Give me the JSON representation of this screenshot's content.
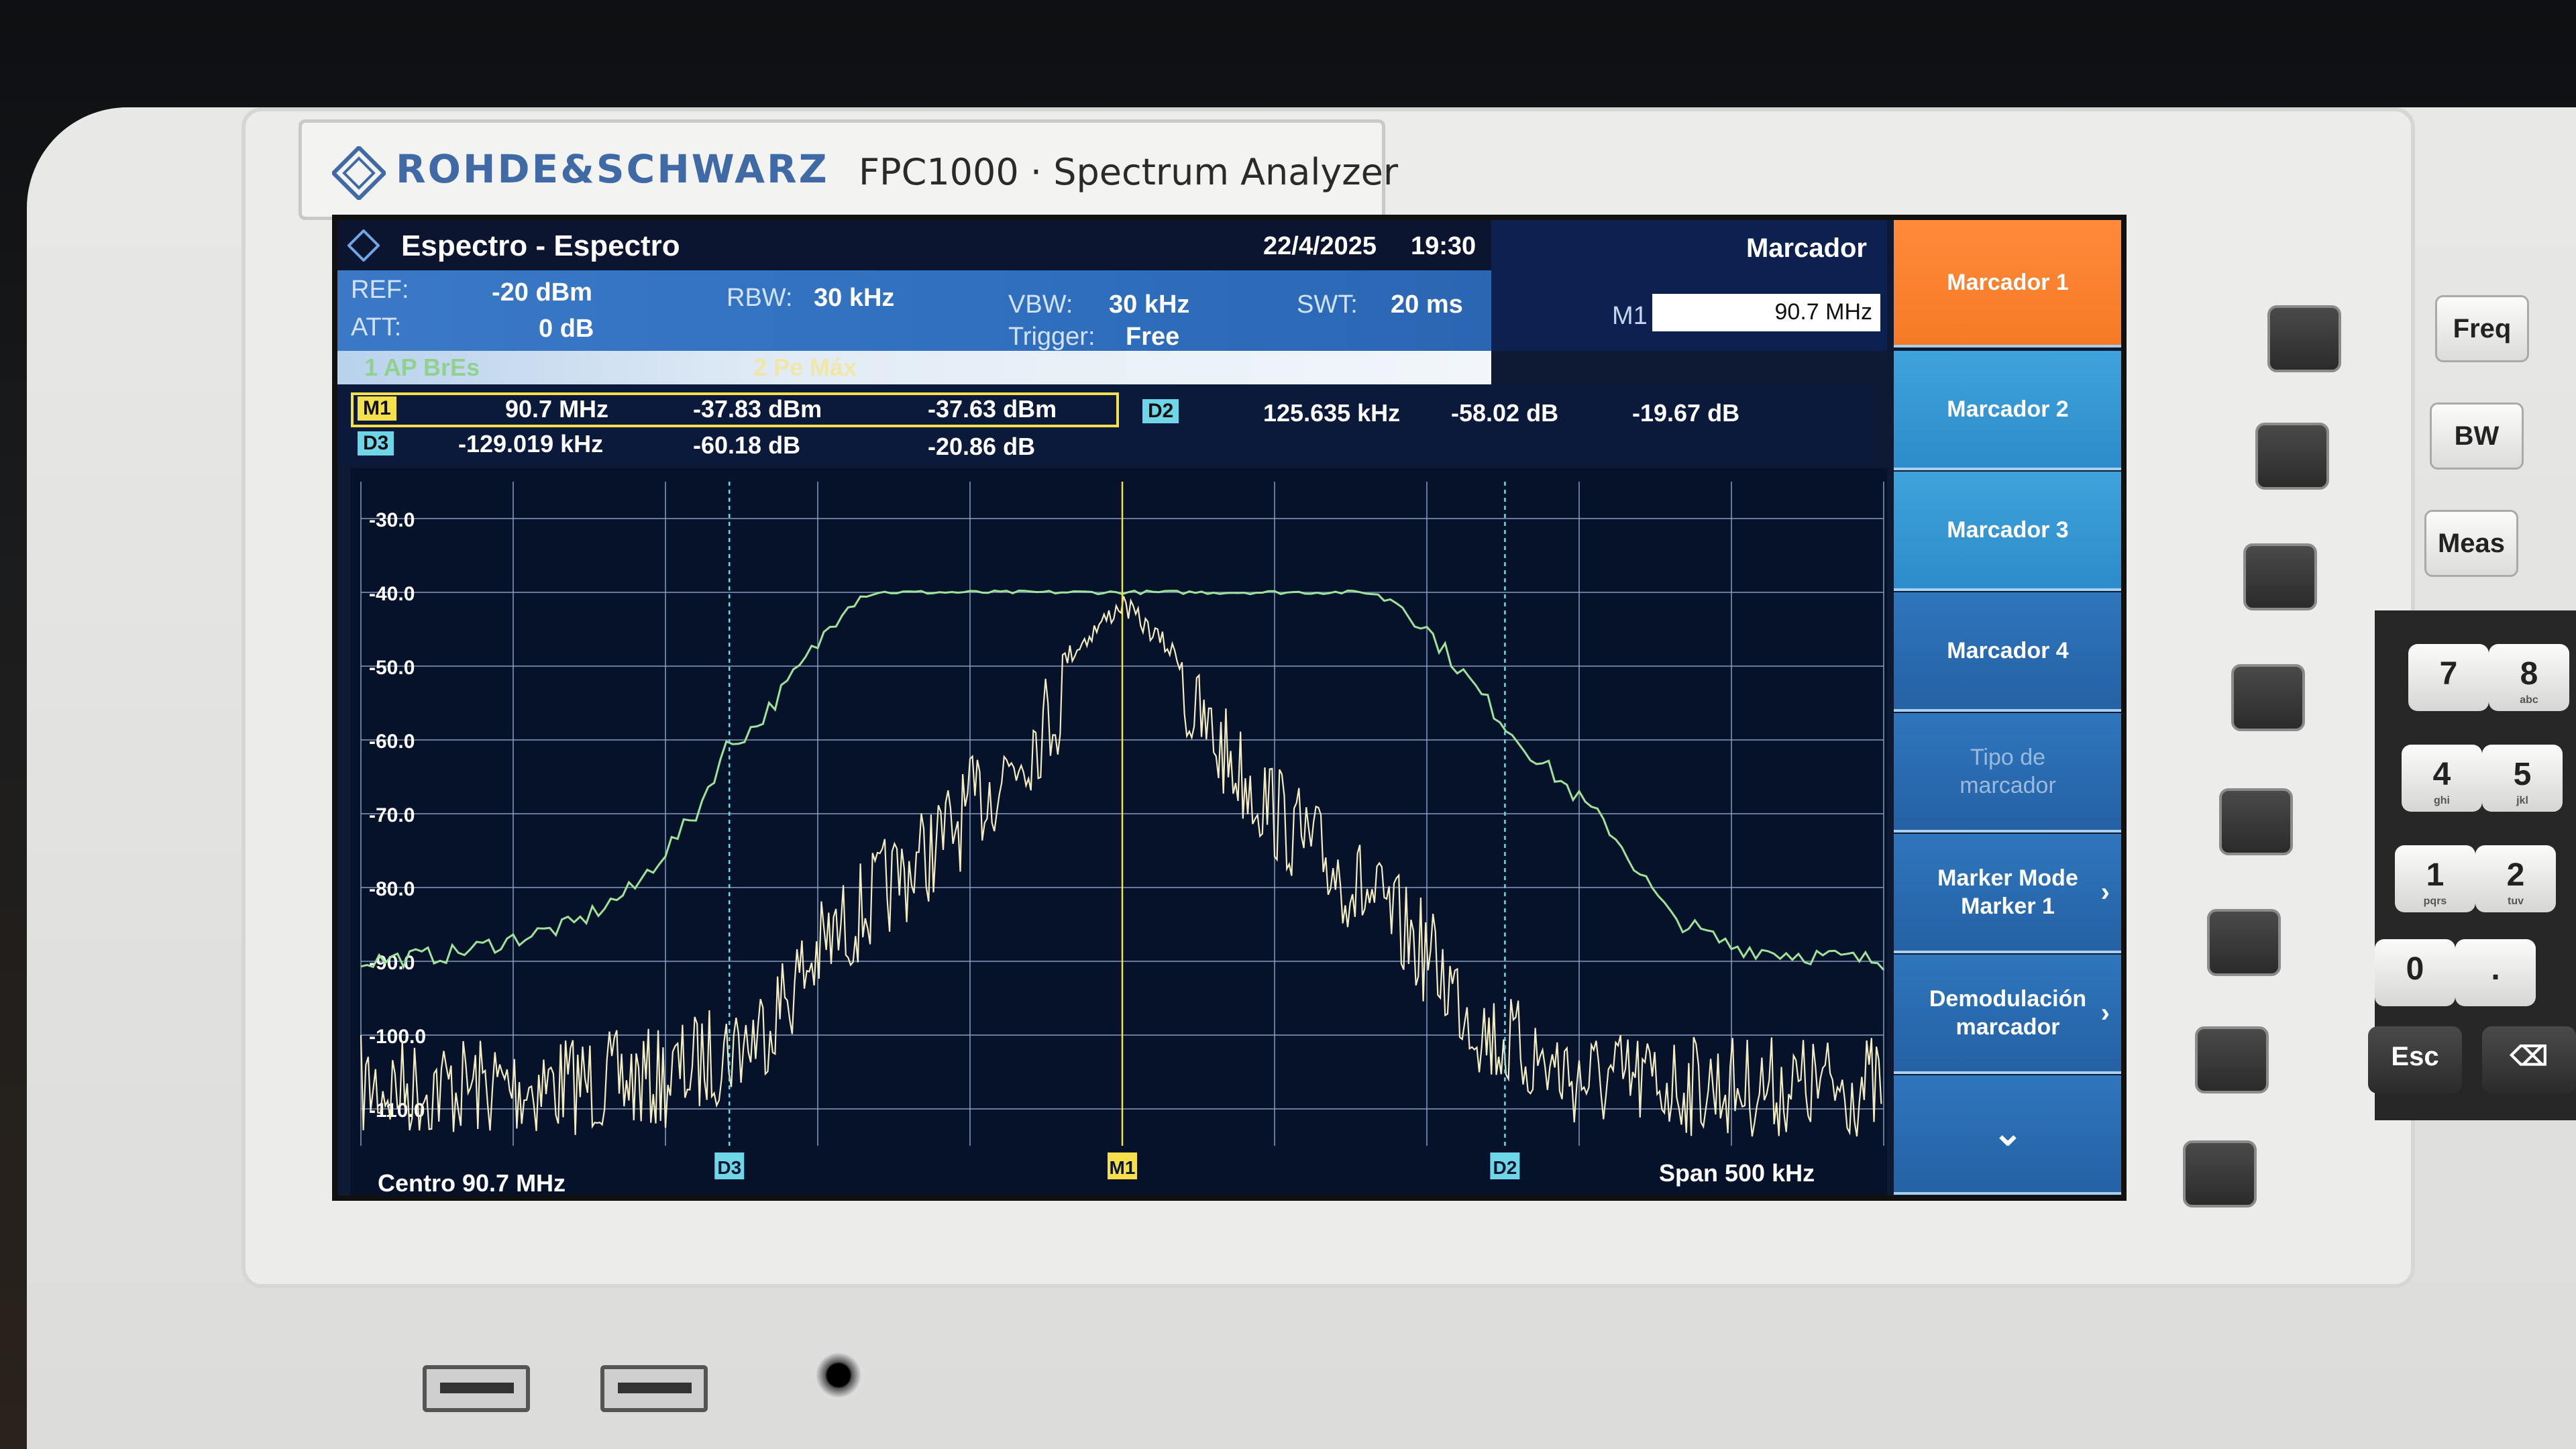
{
  "brand": {
    "name": "ROHDE&SCHWARZ",
    "model": "FPC1000 · Spectrum Analyzer"
  },
  "screen": {
    "title": "Espectro - Espectro",
    "date": "22/4/2025",
    "time": "19:30",
    "params": {
      "ref_label": "REF:",
      "ref_value": "-20 dBm",
      "att_label": "ATT:",
      "att_value": "0 dB",
      "rbw_label": "RBW:",
      "rbw_value": "30 kHz",
      "vbw_label": "VBW:",
      "vbw_value": "30 kHz",
      "trigger_label": "Trigger:",
      "trigger_value": "Free",
      "swt_label": "SWT:",
      "swt_value": "20 ms"
    },
    "trace_tabs": [
      {
        "label": "1 AP BrEs",
        "color": "#8fd18e"
      },
      {
        "label": "2 Pe Máx",
        "color": "#f0e7a6"
      }
    ],
    "markers": {
      "m1": {
        "tag": "M1",
        "x": "90.7 MHz",
        "y": "-37.83 dBm",
        "extra": "-37.63 dBm"
      },
      "d2": {
        "tag": "D2",
        "x": "125.635 kHz",
        "y": "-58.02 dB",
        "extra": "-19.67 dB"
      },
      "d3": {
        "tag": "D3",
        "x": "-129.019 kHz",
        "y": "-60.18 dB",
        "extra": "-20.86 dB"
      }
    },
    "footer": {
      "center": "Centro 90.7 MHz",
      "span": "Span 500 kHz"
    },
    "sidebar": {
      "title": "Marcador",
      "m1_field_label": "M1",
      "m1_field_value": "90.7 MHz",
      "softkeys": [
        {
          "label": "Marcador 1",
          "state": "active"
        },
        {
          "label": "Marcador 2",
          "state": "normal"
        },
        {
          "label": "Marcador 3",
          "state": "normal"
        },
        {
          "label": "Marcador 4",
          "state": "dark"
        },
        {
          "label": "Tipo de marcador",
          "state": "disabled"
        },
        {
          "label": "Marker Mode Marker 1",
          "state": "dark"
        },
        {
          "label": "Demodulación marcador",
          "state": "dark"
        },
        {
          "label": "",
          "state": "dark"
        }
      ]
    }
  },
  "chart_data": {
    "type": "line",
    "x_label": "",
    "y_label": "",
    "y_ticks": [
      "-30.0",
      "-40.0",
      "-50.0",
      "-60.0",
      "-70.0",
      "-80.0",
      "-90.0",
      "-100.0",
      "-110.0"
    ],
    "ylim": [
      -115,
      -25
    ],
    "xlim_khz": [
      -250,
      250
    ],
    "grid": true,
    "series": [
      {
        "name": "1 AP BrEs",
        "color": "#9de39a",
        "x_khz": [
          -250,
          -220,
          -200,
          -180,
          -160,
          -140,
          -130,
          -120,
          -100,
          -90,
          -80,
          -60,
          -40,
          -20,
          0,
          20,
          40,
          60,
          80,
          90,
          100,
          120,
          130,
          140,
          160,
          180,
          200,
          220,
          250
        ],
        "y_dbm": [
          -90,
          -89,
          -87,
          -85,
          -80,
          -70,
          -61,
          -58,
          -47,
          -41,
          -40,
          -40,
          -40,
          -40,
          -40,
          -40,
          -40,
          -40,
          -40,
          -41,
          -45,
          -55,
          -60,
          -64,
          -72,
          -84,
          -88,
          -89,
          -90
        ]
      },
      {
        "name": "2 Pe Máx",
        "color": "#f3ecc0",
        "x_khz": [
          -250,
          -200,
          -150,
          -120,
          -100,
          -80,
          -60,
          -40,
          -20,
          0,
          20,
          40,
          60,
          80,
          100,
          120,
          150,
          200,
          250
        ],
        "y_dbm": [
          -100,
          -100,
          -99,
          -93,
          -82,
          -74,
          -67,
          -58,
          -48,
          -40,
          -48,
          -58,
          -67,
          -74,
          -82,
          -93,
          -99,
          -100,
          -100
        ]
      }
    ],
    "markers": [
      {
        "tag": "M1",
        "x_khz": 0,
        "y_dbm": -37.83,
        "color": "#f5df4a"
      },
      {
        "tag": "D2",
        "x_khz": 125.635,
        "y_dbm": -58.02,
        "color": "#6fd6e8"
      },
      {
        "tag": "D3",
        "x_khz": -129.019,
        "y_dbm": -60.18,
        "color": "#6fd6e8"
      }
    ]
  },
  "hardkeys": {
    "function_keys": [
      "Freq",
      "BW",
      "Meas"
    ],
    "number_keys": [
      {
        "label": "7",
        "sub": ""
      },
      {
        "label": "8",
        "sub": "abc"
      },
      {
        "label": "4",
        "sub": "ghi"
      },
      {
        "label": "5",
        "sub": "jkl"
      },
      {
        "label": "1",
        "sub": "pqrs"
      },
      {
        "label": "2",
        "sub": "tuv"
      },
      {
        "label": "0",
        "sub": ""
      },
      {
        "label": ".",
        "sub": ""
      }
    ],
    "esc": "Esc",
    "backspace": "⌫"
  },
  "colors": {
    "accent": "#f57a26",
    "softkey": "#2d8ccb",
    "screen_bg": "#06112a"
  }
}
